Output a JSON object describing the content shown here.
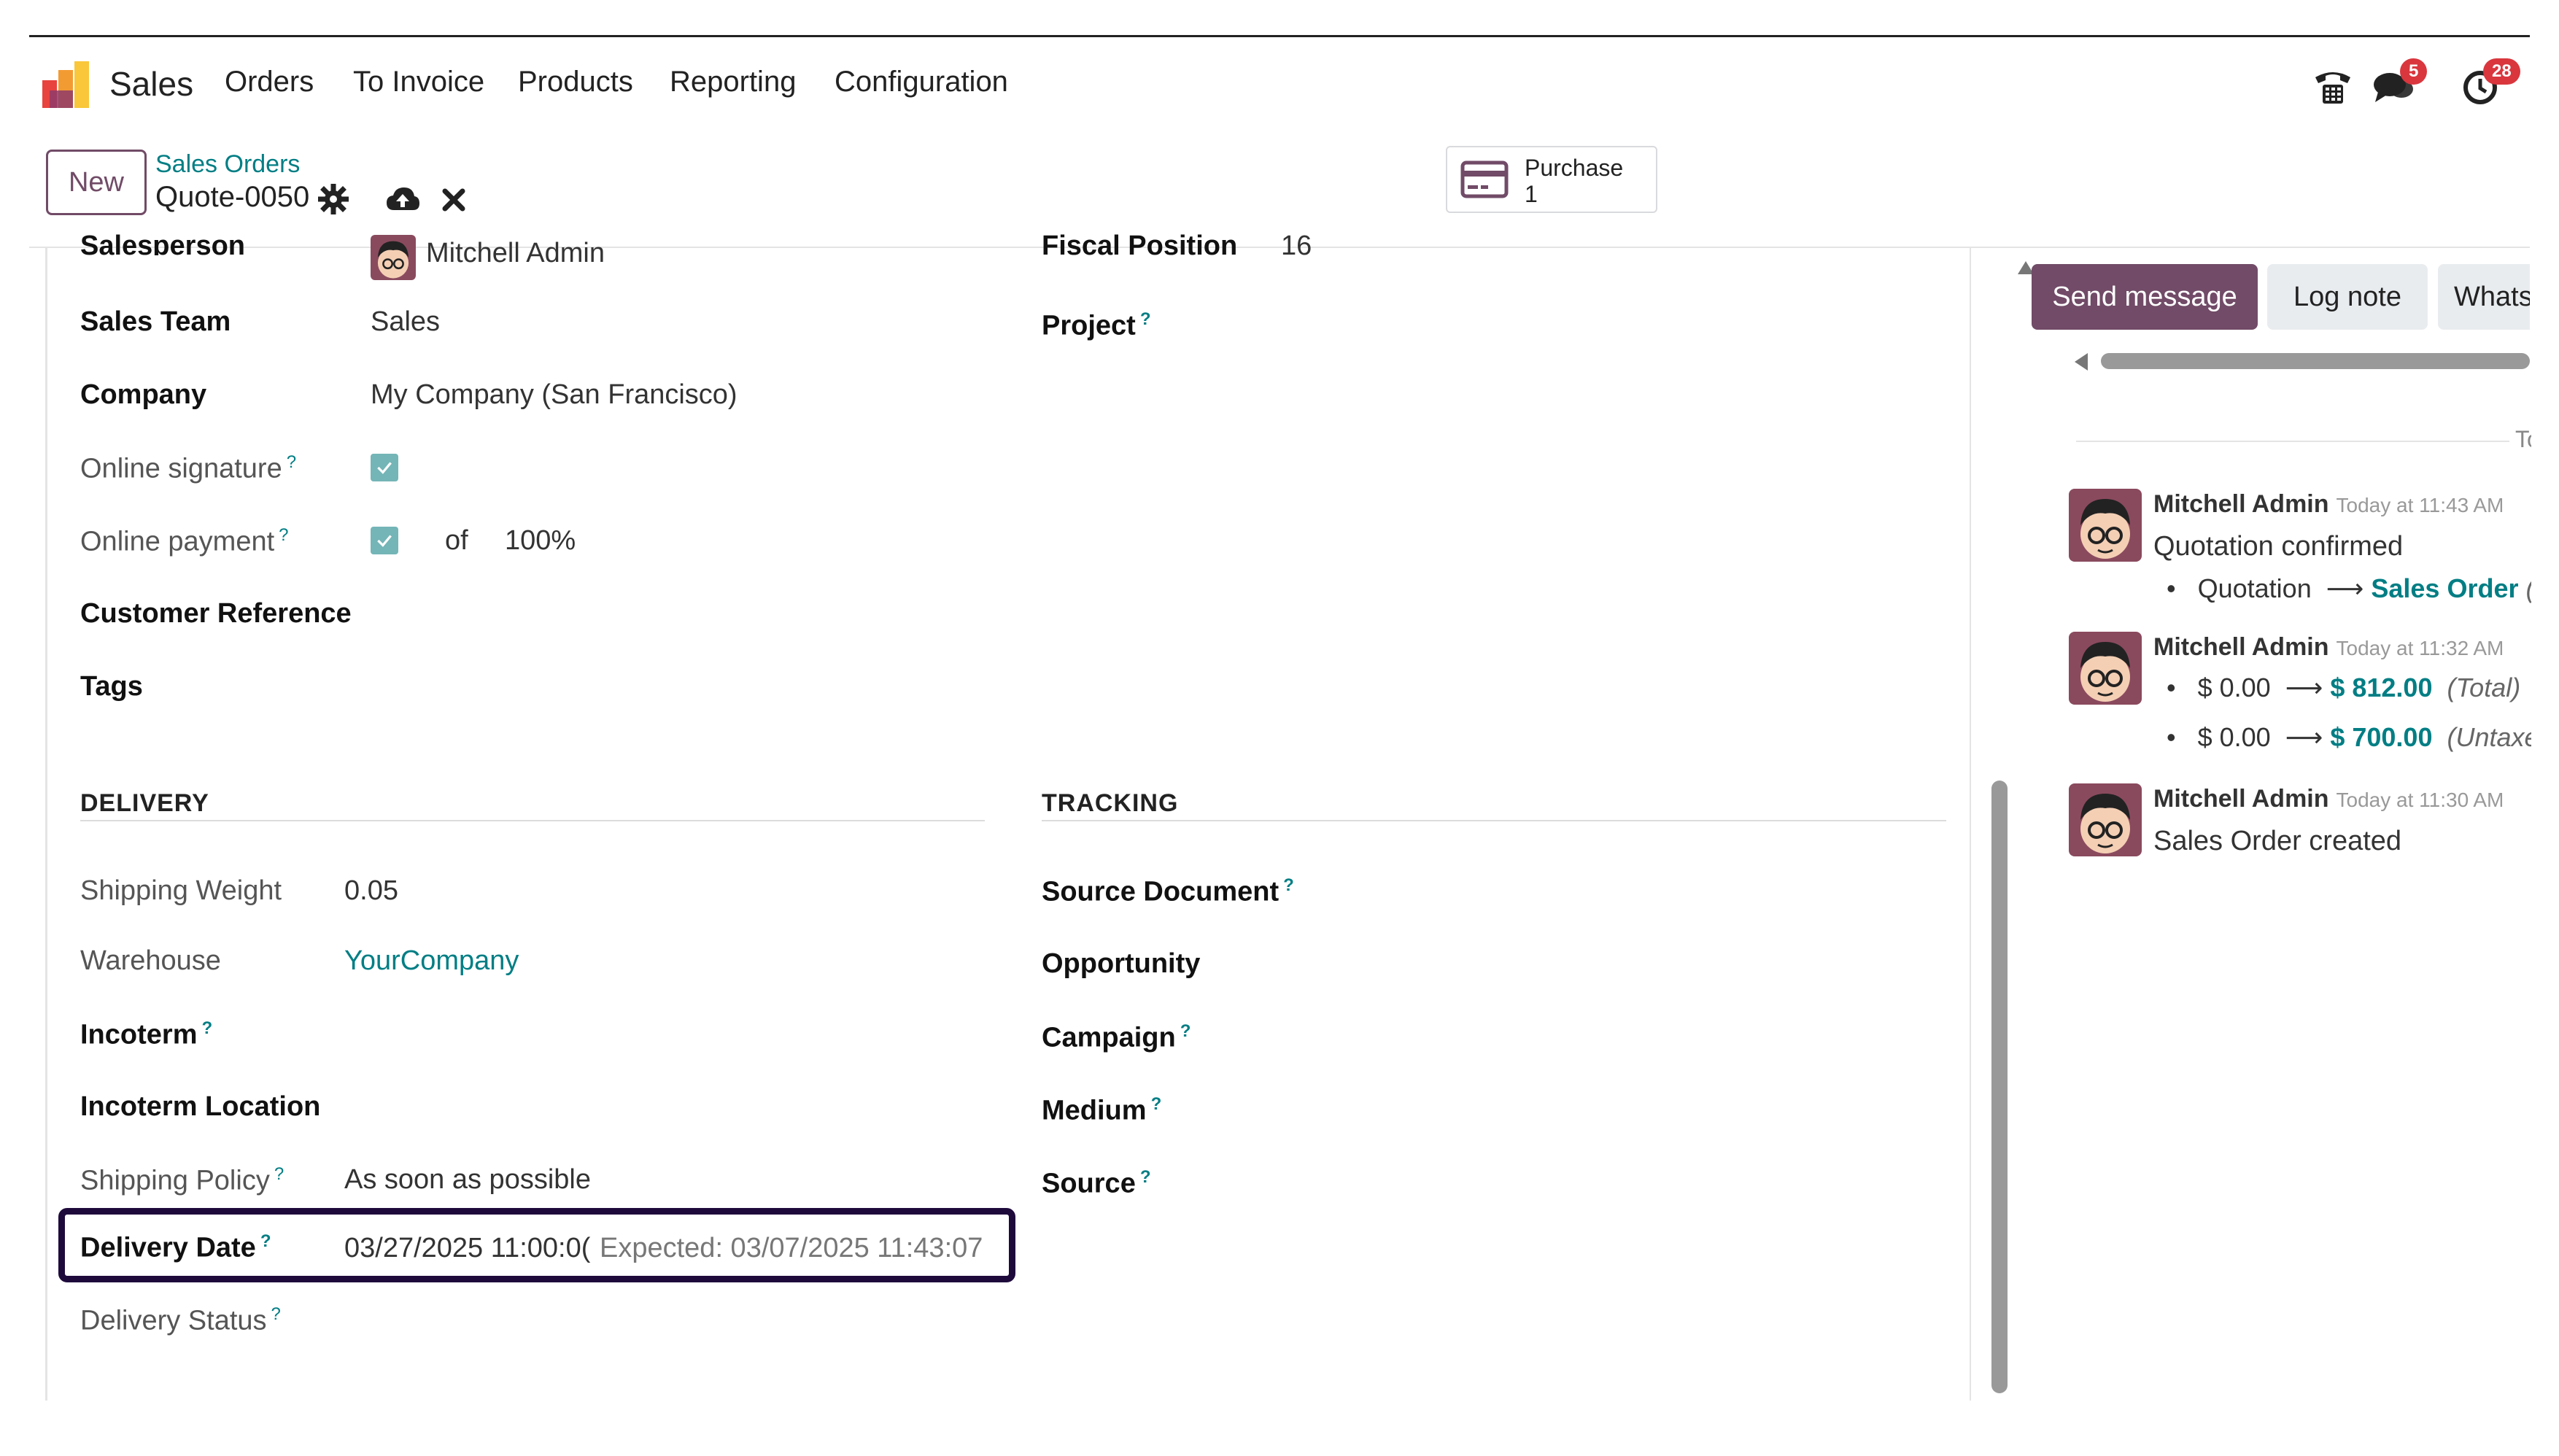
{
  "navbar": {
    "app_name": "Sales",
    "menu": [
      "Orders",
      "To Invoice",
      "Products",
      "Reporting",
      "Configuration"
    ],
    "messages_badge": "5",
    "activities_badge": "28"
  },
  "control": {
    "new_label": "New",
    "breadcrumb_parent": "Sales Orders",
    "breadcrumb_current": "Quote-0050",
    "smart_purchase_label": "Purchase",
    "smart_purchase_count": "1"
  },
  "form": {
    "salesperson_label": "Salesperson",
    "salesperson_value": "Mitchell Admin",
    "fiscal_position_label": "Fiscal Position",
    "fiscal_position_value": "16",
    "sales_team_label": "Sales Team",
    "sales_team_value": "Sales",
    "project_label": "Project",
    "company_label": "Company",
    "company_value": "My Company (San Francisco)",
    "online_signature_label": "Online signature",
    "online_payment_label": "Online payment",
    "online_payment_of": "of",
    "online_payment_percent": "100%",
    "customer_reference_label": "Customer Reference",
    "tags_label": "Tags",
    "delivery_section": "DELIVERY",
    "tracking_section": "TRACKING",
    "shipping_weight_label": "Shipping Weight",
    "shipping_weight_value": "0.05",
    "warehouse_label": "Warehouse",
    "warehouse_value": "YourCompany",
    "incoterm_label": "Incoterm",
    "incoterm_location_label": "Incoterm Location",
    "shipping_policy_label": "Shipping Policy",
    "shipping_policy_value": "As soon as possible",
    "delivery_date_label": "Delivery Date",
    "delivery_date_value": "03/27/2025 11:00:0(",
    "delivery_date_expected": "Expected: 03/07/2025 11:43:07",
    "delivery_status_label": "Delivery Status",
    "source_document_label": "Source Document",
    "opportunity_label": "Opportunity",
    "campaign_label": "Campaign",
    "medium_label": "Medium",
    "source_label": "Source",
    "help_mark": "?"
  },
  "chatter": {
    "send_message": "Send message",
    "log_note": "Log note",
    "whatsapp": "WhatsA",
    "today_divider": "To",
    "messages": [
      {
        "author": "Mitchell Admin",
        "time": "Today at 11:43 AM",
        "text": "Quotation confirmed",
        "changes": [
          {
            "old": "Quotation",
            "new": "Sales Order",
            "note": "(S"
          }
        ]
      },
      {
        "author": "Mitchell Admin",
        "time": "Today at 11:32 AM",
        "text": "",
        "changes": [
          {
            "old": "$ 0.00",
            "new": "$ 812.00",
            "note": "(Total)"
          },
          {
            "old": "$ 0.00",
            "new": "$ 700.00",
            "note": "(Untaxed"
          }
        ]
      },
      {
        "author": "Mitchell Admin",
        "time": "Today at 11:30 AM",
        "text": "Sales Order created",
        "changes": []
      }
    ]
  },
  "colors": {
    "brand": "#714b67",
    "link": "#017e84",
    "badge": "#d9363e",
    "highlight_border": "#1f0a3c"
  }
}
